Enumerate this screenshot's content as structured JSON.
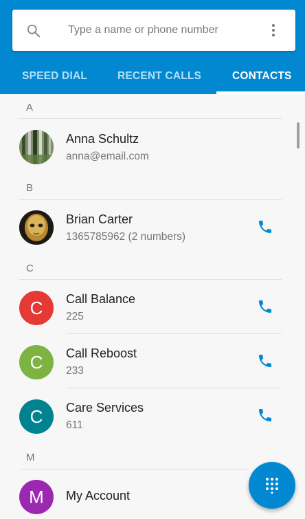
{
  "search": {
    "placeholder": "Type a name or phone number"
  },
  "tabs": [
    {
      "label": "SPEED DIAL"
    },
    {
      "label": "RECENT CALLS"
    },
    {
      "label": "CONTACTS"
    }
  ],
  "sections": [
    {
      "letter": "A"
    },
    {
      "letter": "B"
    },
    {
      "letter": "C"
    },
    {
      "letter": "M"
    }
  ],
  "contacts": [
    {
      "name": "Anna Schultz",
      "detail": "anna@email.com",
      "avatar": "photo-forest"
    },
    {
      "name": "Brian Carter",
      "detail": "1365785962 (2 numbers)",
      "avatar": "photo-mask"
    },
    {
      "name": "Call Balance",
      "detail": "225",
      "initial": "C",
      "color": "#e53935"
    },
    {
      "name": "Call Reboost",
      "detail": "233",
      "initial": "C",
      "color": "#7cb342"
    },
    {
      "name": "Care Services",
      "detail": "611",
      "initial": "C",
      "color": "#00838f"
    },
    {
      "name": "My Account",
      "detail": "",
      "initial": "M",
      "color": "#9c27b0"
    }
  ],
  "colors": {
    "accent": "#0288d1",
    "phone_icon": "#0288d1"
  },
  "icons": {
    "search": "search-icon",
    "more": "more-vert-icon",
    "call": "phone-icon",
    "dialpad": "dialpad-icon"
  }
}
